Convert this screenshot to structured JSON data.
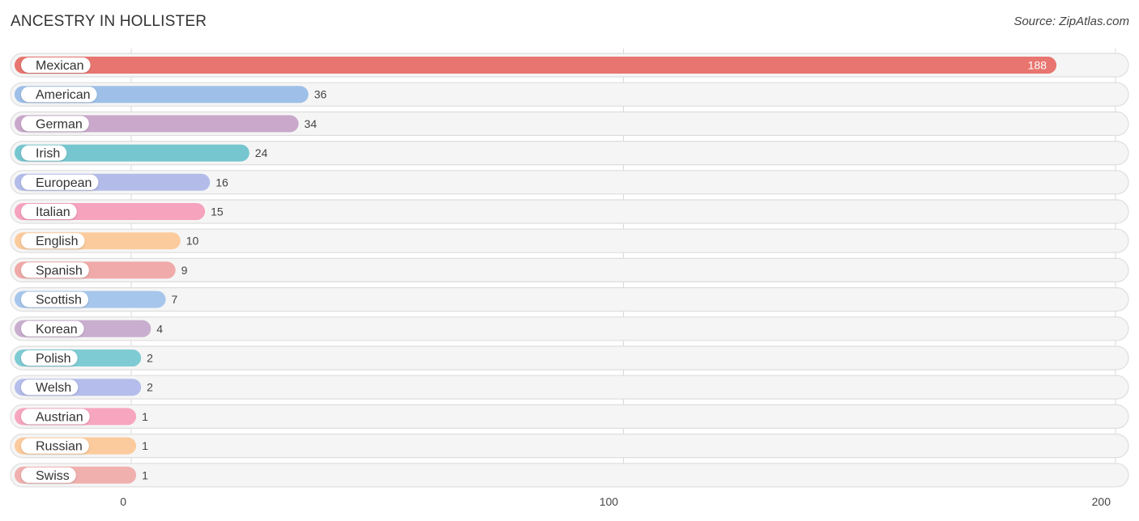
{
  "chart_data": {
    "type": "bar",
    "orientation": "horizontal",
    "title": "ANCESTRY IN HOLLISTER",
    "source": "Source: ZipAtlas.com",
    "xlabel": "",
    "ylabel": "",
    "xlim": [
      0,
      200
    ],
    "x_ticks": [
      0,
      100,
      200
    ],
    "grid": true,
    "categories": [
      "Mexican",
      "American",
      "German",
      "Irish",
      "European",
      "Italian",
      "English",
      "Spanish",
      "Scottish",
      "Korean",
      "Polish",
      "Welsh",
      "Austrian",
      "Russian",
      "Swiss"
    ],
    "values": [
      188,
      36,
      34,
      24,
      16,
      15,
      10,
      9,
      7,
      4,
      2,
      2,
      1,
      1,
      1
    ],
    "colors": [
      "#e8756f",
      "#9ec0e8",
      "#c9a8cc",
      "#76c6cf",
      "#b3bce9",
      "#f6a3be",
      "#fccb9d",
      "#f0aaa9",
      "#a7c6ec",
      "#c9aecf",
      "#7fcbd3",
      "#b4bdeb",
      "#f7a6c0",
      "#fccb9d",
      "#efb0ae"
    ]
  }
}
